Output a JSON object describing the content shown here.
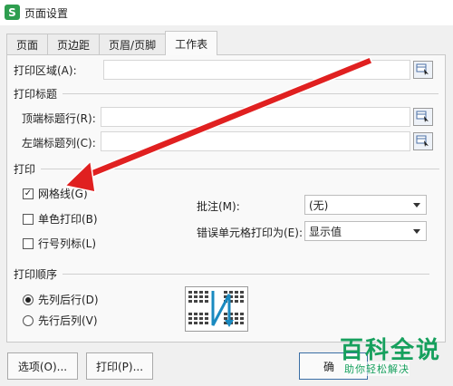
{
  "window": {
    "title": "页面设置",
    "icon_letter": "S"
  },
  "tabs": [
    {
      "label": "页面",
      "active": false
    },
    {
      "label": "页边距",
      "active": false
    },
    {
      "label": "页眉/页脚",
      "active": false
    },
    {
      "label": "工作表",
      "active": true
    }
  ],
  "print_area": {
    "label": "打印区域(A):",
    "value": ""
  },
  "print_titles": {
    "section": "打印标题",
    "top_rows_label": "顶端标题行(R):",
    "top_rows_value": "",
    "left_cols_label": "左端标题列(C):",
    "left_cols_value": ""
  },
  "print": {
    "section": "打印",
    "gridlines": {
      "label": "网格线(G)",
      "checked": true
    },
    "mono": {
      "label": "单色打印(B)",
      "checked": false
    },
    "row_col_headers": {
      "label": "行号列标(L)",
      "checked": false
    },
    "comments_label": "批注(M):",
    "comments_value": "(无)",
    "errors_label": "错误单元格打印为(E):",
    "errors_value": "显示值",
    "check_mark": "✓"
  },
  "order": {
    "section": "打印顺序",
    "down_then_over": {
      "label": "先列后行(D)",
      "selected": true
    },
    "over_then_down": {
      "label": "先行后列(V)",
      "selected": false
    }
  },
  "buttons": {
    "options": "选项(O)...",
    "print": "打印(P)...",
    "ok": "确"
  },
  "watermark": {
    "title": "百科全说",
    "subtitle": "助你轻松解决"
  },
  "colors": {
    "app_icon": "#2e9e4f",
    "annotation_arrow": "#e02020",
    "watermark": "#16a05d"
  }
}
